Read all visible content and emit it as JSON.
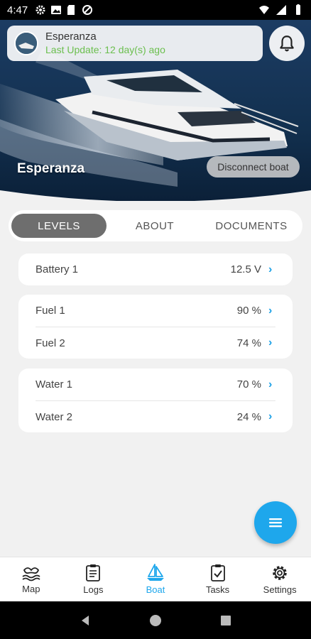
{
  "status_bar": {
    "time": "4:47",
    "left_icons": [
      "gear-icon",
      "image-icon",
      "sd-card-icon",
      "blocked-icon"
    ],
    "right_icons": [
      "wifi-icon",
      "signal-icon",
      "battery-icon"
    ]
  },
  "boat": {
    "name": "Esperanza",
    "last_update": "Last Update: 12 day(s) ago",
    "hero_name": "Esperanza",
    "disconnect_label": "Disconnect boat"
  },
  "tabs": [
    {
      "label": "LEVELS",
      "active": true
    },
    {
      "label": "ABOUT",
      "active": false
    },
    {
      "label": "DOCUMENTS",
      "active": false
    }
  ],
  "levels": {
    "battery": [
      {
        "label": "Battery 1",
        "value": "12.5 V"
      }
    ],
    "fuel": [
      {
        "label": "Fuel 1",
        "value": "90 %"
      },
      {
        "label": "Fuel 2",
        "value": "74 %"
      }
    ],
    "water": [
      {
        "label": "Water 1",
        "value": "70 %"
      },
      {
        "label": "Water 2",
        "value": "24 %"
      }
    ]
  },
  "nav": [
    {
      "label": "Map",
      "icon": "map-icon"
    },
    {
      "label": "Logs",
      "icon": "logs-icon"
    },
    {
      "label": "Boat",
      "icon": "boat-icon",
      "active": true
    },
    {
      "label": "Tasks",
      "icon": "tasks-icon"
    },
    {
      "label": "Settings",
      "icon": "settings-icon"
    }
  ],
  "colors": {
    "accent": "#1ea7ec",
    "update_green": "#6bbf4e",
    "active_tab": "#6e6e6e"
  }
}
